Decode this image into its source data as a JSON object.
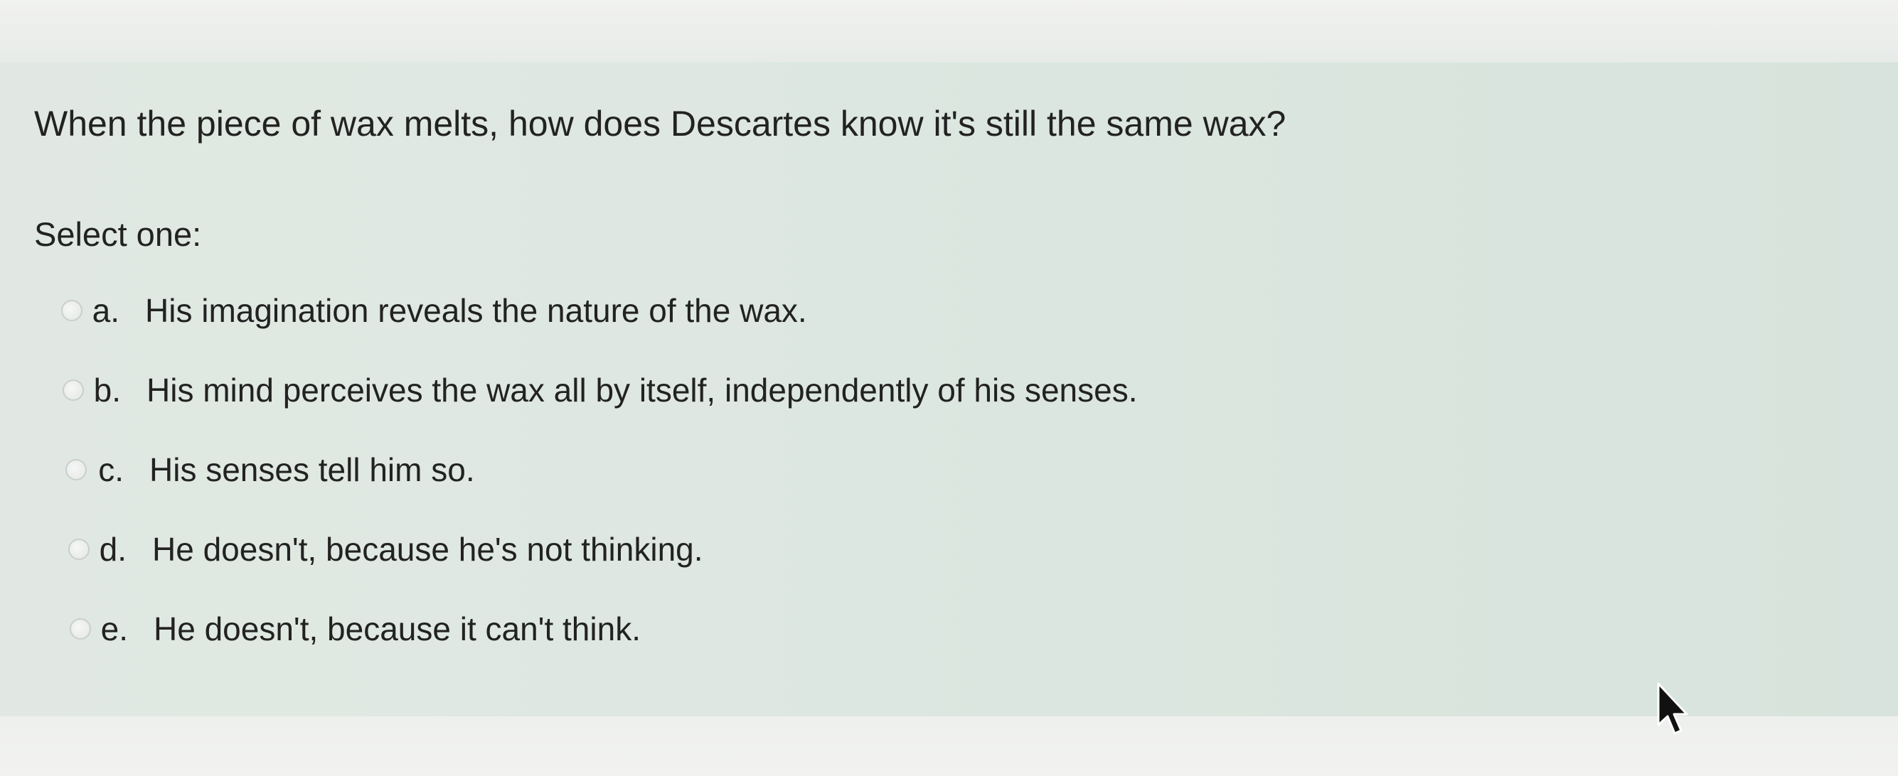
{
  "question": {
    "text": "When the piece of wax melts, how does Descartes know it's still the same wax?",
    "prompt": "Select one:"
  },
  "answers": [
    {
      "letter": "a.",
      "text": "His imagination reveals the nature of the wax."
    },
    {
      "letter": "b.",
      "text": "His mind perceives the wax all by itself, independently of his senses."
    },
    {
      "letter": "c.",
      "text": "His senses tell him so."
    },
    {
      "letter": "d.",
      "text": "He doesn't, because he's not thinking."
    },
    {
      "letter": "e.",
      "text": "He doesn't, because it can't think."
    }
  ],
  "icons": {
    "radio": "radio-button-icon",
    "cursor": "mouse-pointer-icon"
  },
  "colors": {
    "card_background": "#dde7e1",
    "text": "#222222"
  }
}
